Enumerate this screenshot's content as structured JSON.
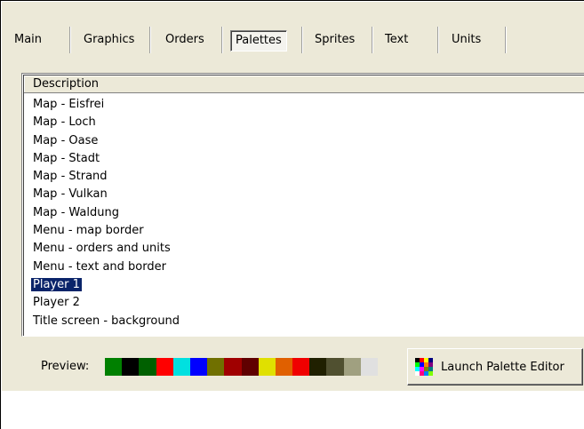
{
  "tabs": [
    {
      "label": "Main",
      "active": false
    },
    {
      "label": "Graphics",
      "active": false
    },
    {
      "label": "Orders",
      "active": false
    },
    {
      "label": "Palettes",
      "active": true
    },
    {
      "label": "Sprites",
      "active": false
    },
    {
      "label": "Text",
      "active": false
    },
    {
      "label": "Units",
      "active": false
    }
  ],
  "list": {
    "column_header": "Description",
    "items": [
      "Map - Eisfrei",
      "Map - Loch",
      "Map - Oase",
      "Map - Stadt",
      "Map - Strand",
      "Map - Vulkan",
      "Map - Waldung",
      "Menu - map border",
      "Menu - orders and units",
      "Menu - text and border",
      "Player 1",
      "Player 2",
      "Title screen - background"
    ],
    "selected_index": 10
  },
  "preview": {
    "label": "Preview:",
    "colors": [
      "#008000",
      "#000000",
      "#006000",
      "#ff0000",
      "#00e0e0",
      "#0000ff",
      "#707000",
      "#a00000",
      "#600000",
      "#e0e000",
      "#e06000",
      "#f00000",
      "#202000",
      "#505030",
      "#a0a080",
      "#e0e0e0"
    ]
  },
  "launch_button": {
    "label": "Launch Palette Editor",
    "icon": "palette-grid-icon",
    "icon_colors": [
      "#000000",
      "#ff0000",
      "#ffff00",
      "#000080",
      "#00ff00",
      "#0000ff",
      "#ff8000",
      "#800080",
      "#00ffff",
      "#ff00ff",
      "#808000",
      "#008080",
      "#ffffff",
      "#ff0080",
      "#0080ff",
      "#80ff00"
    ]
  }
}
